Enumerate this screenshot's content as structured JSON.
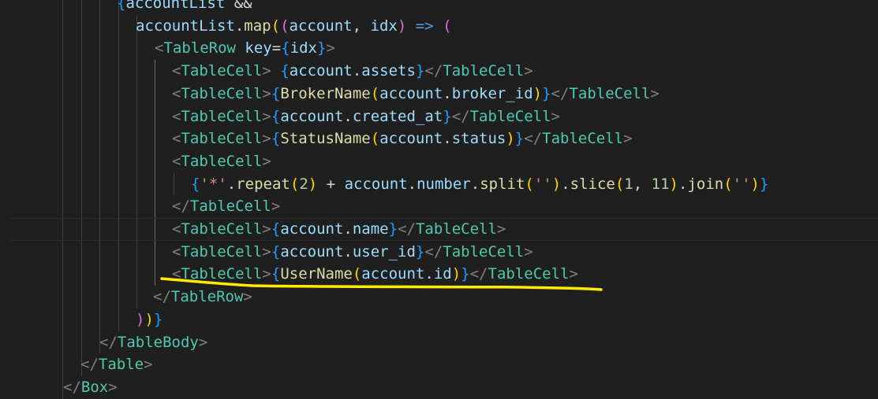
{
  "editor": {
    "colors": {
      "background": "#1f1f1f",
      "tag": "#808080",
      "component": "#4ec9b0",
      "variable": "#9cdcfe",
      "function": "#dcdcaa",
      "brace": "#179fff",
      "bracket_gold": "#ffd700",
      "bracket_purple": "#da70d6",
      "keyword": "#569cd6",
      "string": "#ce9178",
      "number": "#b5cea8",
      "text": "#d4d4d4",
      "annotation": "#ffea00"
    },
    "lines": [
      {
        "tokens": [
          {
            "t": "{",
            "c": "brace"
          },
          {
            "t": "accountList",
            "c": "variable"
          },
          {
            "t": " &&",
            "c": "text"
          }
        ]
      },
      {
        "tokens": [
          {
            "t": "accountList",
            "c": "variable"
          },
          {
            "t": ".",
            "c": "text"
          },
          {
            "t": "map",
            "c": "function"
          },
          {
            "t": "(",
            "c": "bracket_gold"
          },
          {
            "t": "(",
            "c": "bracket_purple"
          },
          {
            "t": "account",
            "c": "variable"
          },
          {
            "t": ", ",
            "c": "text"
          },
          {
            "t": "idx",
            "c": "variable"
          },
          {
            "t": ")",
            "c": "bracket_purple"
          },
          {
            "t": " ",
            "c": "text"
          },
          {
            "t": "=>",
            "c": "keyword"
          },
          {
            "t": " ",
            "c": "text"
          },
          {
            "t": "(",
            "c": "bracket_purple"
          }
        ]
      },
      {
        "tokens": [
          {
            "t": "<",
            "c": "tag"
          },
          {
            "t": "TableRow",
            "c": "component"
          },
          {
            "t": " ",
            "c": "text"
          },
          {
            "t": "key",
            "c": "variable"
          },
          {
            "t": "=",
            "c": "text"
          },
          {
            "t": "{",
            "c": "brace"
          },
          {
            "t": "idx",
            "c": "variable"
          },
          {
            "t": "}",
            "c": "brace"
          },
          {
            "t": ">",
            "c": "tag"
          }
        ]
      },
      {
        "tokens": [
          {
            "t": "<",
            "c": "tag"
          },
          {
            "t": "TableCell",
            "c": "component"
          },
          {
            "t": ">",
            "c": "tag"
          },
          {
            "t": " ",
            "c": "text"
          },
          {
            "t": "{",
            "c": "brace"
          },
          {
            "t": "account",
            "c": "variable"
          },
          {
            "t": ".",
            "c": "text"
          },
          {
            "t": "assets",
            "c": "variable"
          },
          {
            "t": "}",
            "c": "brace"
          },
          {
            "t": "</",
            "c": "tag"
          },
          {
            "t": "TableCell",
            "c": "component"
          },
          {
            "t": ">",
            "c": "tag"
          }
        ]
      },
      {
        "tokens": [
          {
            "t": "<",
            "c": "tag"
          },
          {
            "t": "TableCell",
            "c": "component"
          },
          {
            "t": ">",
            "c": "tag"
          },
          {
            "t": "{",
            "c": "brace"
          },
          {
            "t": "BrokerName",
            "c": "function"
          },
          {
            "t": "(",
            "c": "bracket_gold"
          },
          {
            "t": "account",
            "c": "variable"
          },
          {
            "t": ".",
            "c": "text"
          },
          {
            "t": "broker_id",
            "c": "variable"
          },
          {
            "t": ")",
            "c": "bracket_gold"
          },
          {
            "t": "}",
            "c": "brace"
          },
          {
            "t": "</",
            "c": "tag"
          },
          {
            "t": "TableCell",
            "c": "component"
          },
          {
            "t": ">",
            "c": "tag"
          }
        ]
      },
      {
        "tokens": [
          {
            "t": "<",
            "c": "tag"
          },
          {
            "t": "TableCell",
            "c": "component"
          },
          {
            "t": ">",
            "c": "tag"
          },
          {
            "t": "{",
            "c": "brace"
          },
          {
            "t": "account",
            "c": "variable"
          },
          {
            "t": ".",
            "c": "text"
          },
          {
            "t": "created_at",
            "c": "variable"
          },
          {
            "t": "}",
            "c": "brace"
          },
          {
            "t": "</",
            "c": "tag"
          },
          {
            "t": "TableCell",
            "c": "component"
          },
          {
            "t": ">",
            "c": "tag"
          }
        ]
      },
      {
        "tokens": [
          {
            "t": "<",
            "c": "tag"
          },
          {
            "t": "TableCell",
            "c": "component"
          },
          {
            "t": ">",
            "c": "tag"
          },
          {
            "t": "{",
            "c": "brace"
          },
          {
            "t": "StatusName",
            "c": "function"
          },
          {
            "t": "(",
            "c": "bracket_gold"
          },
          {
            "t": "account",
            "c": "variable"
          },
          {
            "t": ".",
            "c": "text"
          },
          {
            "t": "status",
            "c": "variable"
          },
          {
            "t": ")",
            "c": "bracket_gold"
          },
          {
            "t": "}",
            "c": "brace"
          },
          {
            "t": "</",
            "c": "tag"
          },
          {
            "t": "TableCell",
            "c": "component"
          },
          {
            "t": ">",
            "c": "tag"
          }
        ]
      },
      {
        "tokens": [
          {
            "t": "<",
            "c": "tag"
          },
          {
            "t": "TableCell",
            "c": "component"
          },
          {
            "t": ">",
            "c": "tag"
          }
        ]
      },
      {
        "tokens": [
          {
            "t": "{",
            "c": "brace"
          },
          {
            "t": "'*'",
            "c": "string"
          },
          {
            "t": ".",
            "c": "text"
          },
          {
            "t": "repeat",
            "c": "function"
          },
          {
            "t": "(",
            "c": "bracket_gold"
          },
          {
            "t": "2",
            "c": "number"
          },
          {
            "t": ")",
            "c": "bracket_gold"
          },
          {
            "t": " + ",
            "c": "text"
          },
          {
            "t": "account",
            "c": "variable"
          },
          {
            "t": ".",
            "c": "text"
          },
          {
            "t": "number",
            "c": "variable"
          },
          {
            "t": ".",
            "c": "text"
          },
          {
            "t": "split",
            "c": "function"
          },
          {
            "t": "(",
            "c": "bracket_gold"
          },
          {
            "t": "''",
            "c": "string"
          },
          {
            "t": ")",
            "c": "bracket_gold"
          },
          {
            "t": ".",
            "c": "text"
          },
          {
            "t": "slice",
            "c": "function"
          },
          {
            "t": "(",
            "c": "bracket_gold"
          },
          {
            "t": "1",
            "c": "number"
          },
          {
            "t": ", ",
            "c": "text"
          },
          {
            "t": "11",
            "c": "number"
          },
          {
            "t": ")",
            "c": "bracket_gold"
          },
          {
            "t": ".",
            "c": "text"
          },
          {
            "t": "join",
            "c": "function"
          },
          {
            "t": "(",
            "c": "bracket_gold"
          },
          {
            "t": "''",
            "c": "string"
          },
          {
            "t": ")",
            "c": "bracket_gold"
          },
          {
            "t": "}",
            "c": "brace"
          }
        ]
      },
      {
        "tokens": [
          {
            "t": "</",
            "c": "tag"
          },
          {
            "t": "TableCell",
            "c": "component"
          },
          {
            "t": ">",
            "c": "tag"
          }
        ]
      },
      {
        "tokens": [
          {
            "t": "<",
            "c": "tag"
          },
          {
            "t": "TableCell",
            "c": "component"
          },
          {
            "t": ">",
            "c": "tag"
          },
          {
            "t": "{",
            "c": "brace"
          },
          {
            "t": "account",
            "c": "variable"
          },
          {
            "t": ".",
            "c": "text"
          },
          {
            "t": "name",
            "c": "variable"
          },
          {
            "t": "}",
            "c": "brace"
          },
          {
            "t": "</",
            "c": "tag"
          },
          {
            "t": "TableCell",
            "c": "component"
          },
          {
            "t": ">",
            "c": "tag"
          }
        ]
      },
      {
        "tokens": [
          {
            "t": "<",
            "c": "tag"
          },
          {
            "t": "TableCell",
            "c": "component"
          },
          {
            "t": ">",
            "c": "tag"
          },
          {
            "t": "{",
            "c": "brace"
          },
          {
            "t": "account",
            "c": "variable"
          },
          {
            "t": ".",
            "c": "text"
          },
          {
            "t": "user_id",
            "c": "variable"
          },
          {
            "t": "}",
            "c": "brace"
          },
          {
            "t": "</",
            "c": "tag"
          },
          {
            "t": "TableCell",
            "c": "component"
          },
          {
            "t": ">",
            "c": "tag"
          }
        ]
      },
      {
        "tokens": [
          {
            "t": "<",
            "c": "tag"
          },
          {
            "t": "TableCell",
            "c": "component"
          },
          {
            "t": ">",
            "c": "tag"
          },
          {
            "t": "{",
            "c": "brace"
          },
          {
            "t": "UserName",
            "c": "function"
          },
          {
            "t": "(",
            "c": "bracket_gold"
          },
          {
            "t": "account",
            "c": "variable"
          },
          {
            "t": ".",
            "c": "text"
          },
          {
            "t": "id",
            "c": "variable"
          },
          {
            "t": ")",
            "c": "bracket_gold"
          },
          {
            "t": "}",
            "c": "brace"
          },
          {
            "t": "</",
            "c": "tag"
          },
          {
            "t": "TableCell",
            "c": "component"
          },
          {
            "t": ">",
            "c": "tag"
          }
        ]
      },
      {
        "tokens": [
          {
            "t": "</",
            "c": "tag"
          },
          {
            "t": "TableRow",
            "c": "component"
          },
          {
            "t": ">",
            "c": "tag"
          }
        ]
      },
      {
        "tokens": [
          {
            "t": ")",
            "c": "bracket_purple"
          },
          {
            "t": ")",
            "c": "bracket_gold"
          },
          {
            "t": "}",
            "c": "brace"
          }
        ]
      },
      {
        "tokens": [
          {
            "t": "</",
            "c": "tag"
          },
          {
            "t": "TableBody",
            "c": "component"
          },
          {
            "t": ">",
            "c": "tag"
          }
        ]
      },
      {
        "tokens": [
          {
            "t": "</",
            "c": "tag"
          },
          {
            "t": "Table",
            "c": "component"
          },
          {
            "t": ">",
            "c": "tag"
          }
        ]
      },
      {
        "tokens": [
          {
            "t": "</",
            "c": "tag"
          },
          {
            "t": "Box",
            "c": "component"
          },
          {
            "t": ">",
            "c": "tag"
          }
        ]
      }
    ],
    "annotation": {
      "type": "hand-drawn-underline",
      "color": "#ffea00"
    }
  }
}
